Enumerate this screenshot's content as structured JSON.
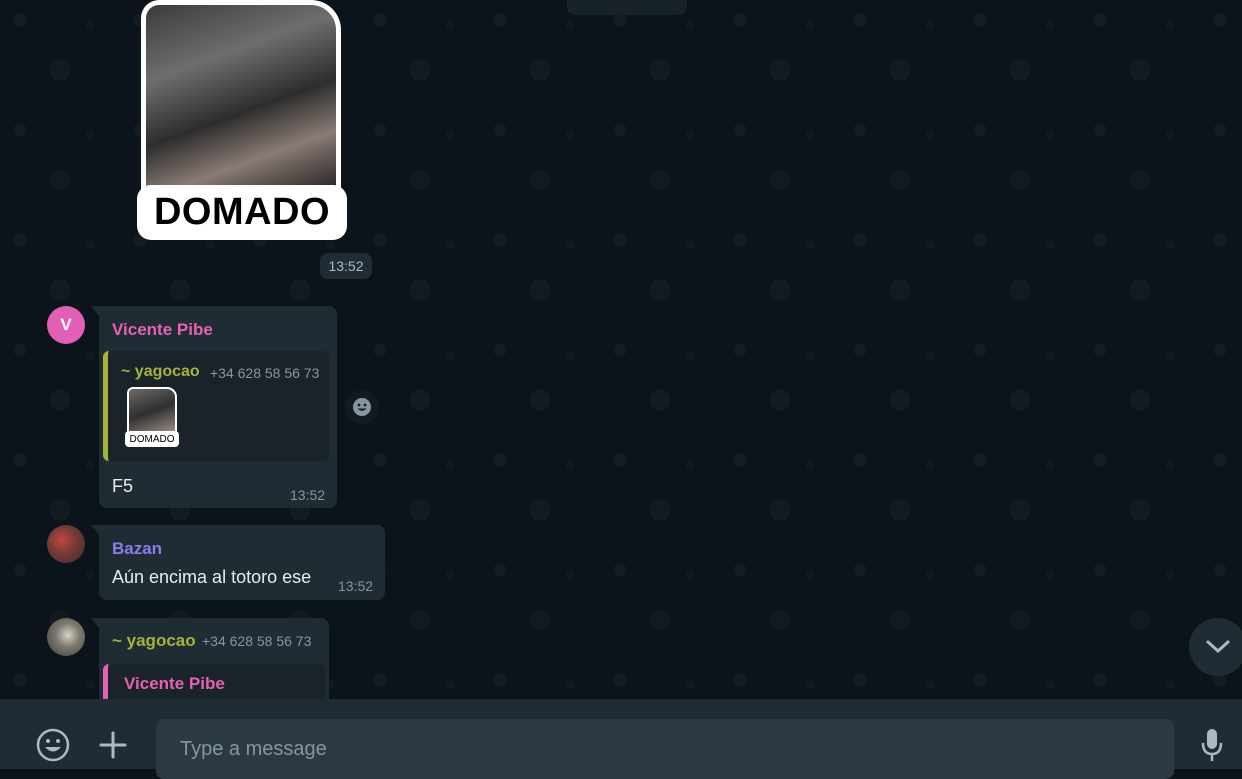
{
  "sticker": {
    "label": "DOMADO",
    "time": "13:52"
  },
  "messages": [
    {
      "avatar_initial": "V",
      "sender": "Vicente Pibe",
      "quote": {
        "author": "~ yagocao",
        "phone": "+34 628 58 56 73",
        "sticker_label": "DOMADO"
      },
      "text": "F5",
      "time": "13:52"
    },
    {
      "sender": "Bazan",
      "text": "Aún encima al totoro ese",
      "time": "13:52"
    },
    {
      "sender": "~ yagocao",
      "phone": "+34 628 58 56 73",
      "quote": {
        "author": "Vicente Pibe"
      }
    }
  ],
  "composer": {
    "placeholder": "Type a message"
  },
  "colors": {
    "panel": "#202c33",
    "background": "#0b141a",
    "pink": "#e760b3",
    "purple": "#8a7bf0",
    "olive": "#a5b337"
  },
  "icons": [
    "emoji-icon",
    "plus-icon",
    "mic-icon",
    "chevron-down-icon",
    "react-emoji-icon"
  ]
}
